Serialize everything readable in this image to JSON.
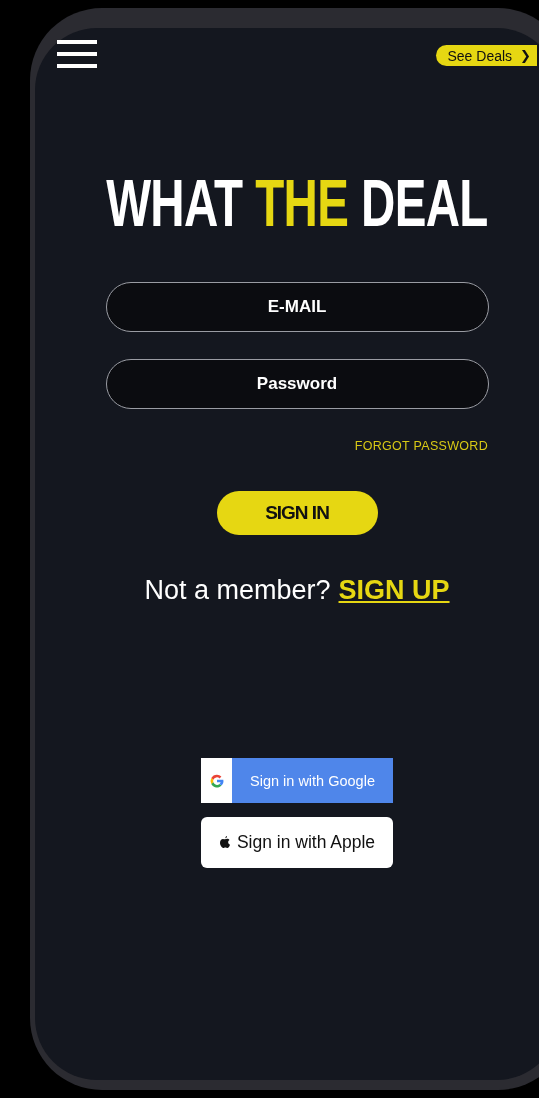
{
  "header": {
    "deals_button": "See Deals",
    "deals_arrow": "❯"
  },
  "logo": [
    {
      "text": "WHAT",
      "highlight": false
    },
    {
      "text": "THE",
      "highlight": true
    },
    {
      "text": "DEAL",
      "highlight": false
    }
  ],
  "fields": [
    {
      "placeholder": "E-MAIL"
    },
    {
      "placeholder": "Password"
    }
  ],
  "forgot_link": "FORGOT PASSWORD",
  "sign_in_button": "SIGN IN",
  "signup": {
    "prompt": "Not a member?",
    "link": "SIGN UP"
  },
  "social": [
    {
      "kind": "google",
      "label": "Sign in with Google"
    },
    {
      "kind": "apple",
      "label": "Sign in with Apple"
    }
  ]
}
